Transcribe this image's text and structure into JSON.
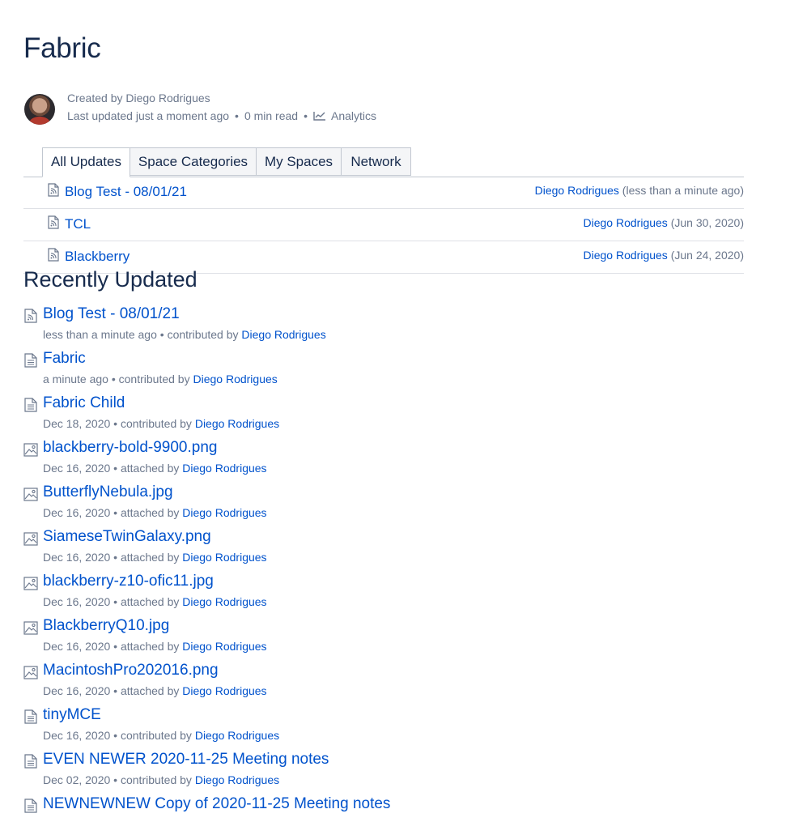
{
  "page": {
    "title": "Fabric",
    "byline": {
      "created_prefix": "Created by Diego Rodrigues",
      "last_updated": "Last updated just a moment ago",
      "read_time": "0 min read",
      "analytics_label": "Analytics",
      "separator": "•"
    }
  },
  "tabs": [
    {
      "label": "All Updates",
      "active": true
    },
    {
      "label": "Space Categories",
      "active": false
    },
    {
      "label": "My Spaces",
      "active": false
    },
    {
      "label": "Network",
      "active": false
    }
  ],
  "updates": [
    {
      "title": "Blog Test - 08/01/21",
      "author": "Diego Rodrigues",
      "when": "(less than a minute ago)",
      "icon": "blog-post-icon"
    },
    {
      "title": "TCL",
      "author": "Diego Rodrigues",
      "when": "(Jun 30, 2020)",
      "icon": "blog-post-icon"
    },
    {
      "title": "Blackberry",
      "author": "Diego Rodrigues",
      "when": "(Jun 24, 2020)",
      "icon": "blog-post-icon"
    }
  ],
  "recently_updated": {
    "heading": "Recently Updated",
    "items": [
      {
        "title": "Blog Test - 08/01/21",
        "date": "less than a minute ago",
        "action": "contributed by",
        "author": "Diego Rodrigues",
        "icon": "blog-post-icon"
      },
      {
        "title": "Fabric",
        "date": "a minute ago",
        "action": "contributed by",
        "author": "Diego Rodrigues",
        "icon": "page-icon"
      },
      {
        "title": "Fabric Child",
        "date": "Dec 18, 2020",
        "action": "contributed by",
        "author": "Diego Rodrigues",
        "icon": "page-icon"
      },
      {
        "title": "blackberry-bold-9900.png",
        "date": "Dec 16, 2020",
        "action": "attached by",
        "author": "Diego Rodrigues",
        "icon": "image-icon"
      },
      {
        "title": "ButterflyNebula.jpg",
        "date": "Dec 16, 2020",
        "action": "attached by",
        "author": "Diego Rodrigues",
        "icon": "image-icon"
      },
      {
        "title": "SiameseTwinGalaxy.png",
        "date": "Dec 16, 2020",
        "action": "attached by",
        "author": "Diego Rodrigues",
        "icon": "image-icon"
      },
      {
        "title": "blackberry-z10-ofic11.jpg",
        "date": "Dec 16, 2020",
        "action": "attached by",
        "author": "Diego Rodrigues",
        "icon": "image-icon"
      },
      {
        "title": "BlackberryQ10.jpg",
        "date": "Dec 16, 2020",
        "action": "attached by",
        "author": "Diego Rodrigues",
        "icon": "image-icon"
      },
      {
        "title": "MacintoshPro202016.png",
        "date": "Dec 16, 2020",
        "action": "attached by",
        "author": "Diego Rodrigues",
        "icon": "image-icon"
      },
      {
        "title": "tinyMCE",
        "date": "Dec 16, 2020",
        "action": "contributed by",
        "author": "Diego Rodrigues",
        "icon": "page-icon"
      },
      {
        "title": "EVEN NEWER 2020-11-25 Meeting notes",
        "date": "Dec 02, 2020",
        "action": "contributed by",
        "author": "Diego Rodrigues",
        "icon": "page-icon"
      },
      {
        "title": "NEWNEWNEW Copy of 2020-11-25 Meeting notes",
        "date": "",
        "action": "",
        "author": "",
        "icon": "page-icon"
      }
    ]
  },
  "colors": {
    "link": "#0052cc",
    "text": "#172b4d",
    "subtle": "#6b778c",
    "border": "#c1c7d0"
  }
}
